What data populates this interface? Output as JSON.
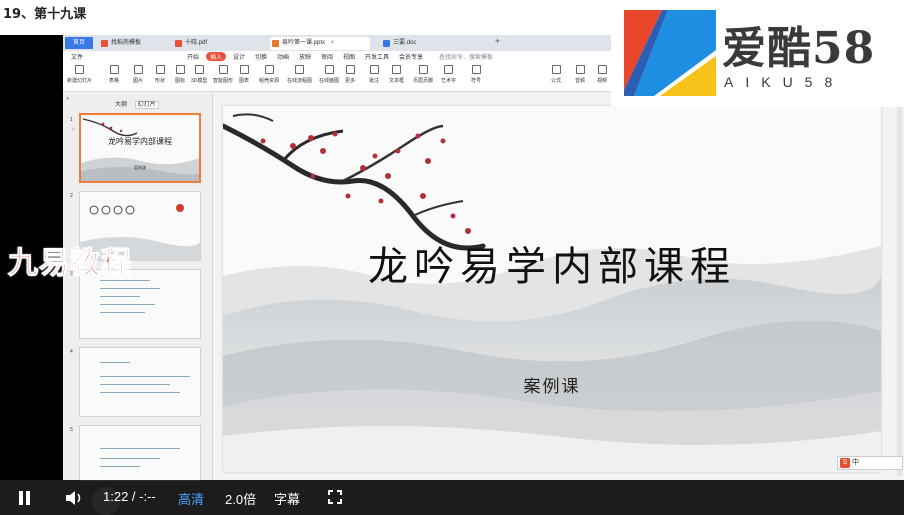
{
  "lesson_title": "19、第十九课",
  "logo": {
    "word": "爱酷58",
    "sub": "AIKU58",
    "colors": [
      "#e8452b",
      "#f6c21a",
      "#1e8ee2",
      "#2c5fb4"
    ]
  },
  "tabs": [
    {
      "label": "首页",
      "type": "home"
    },
    {
      "label": "找稻壳模板",
      "icon_color": "#e94f3c"
    },
    {
      "label": "十晓.pdf",
      "icon_color": "#e94f3c"
    },
    {
      "label": "易吟第一课.pptx",
      "icon_color": "#e87a2a",
      "active": true
    },
    {
      "label": "三要.doc",
      "icon_color": "#3b78e7"
    }
  ],
  "ribbon_menu": [
    "文件",
    "开始",
    "插入",
    "设计",
    "切换",
    "动画",
    "放映",
    "审阅",
    "视图",
    "开发工具",
    "会员专享",
    "查找命令、搜索模板"
  ],
  "ribbon_tools": [
    "新建幻灯片",
    "表格",
    "图片",
    "形状",
    "图标",
    "3D模型",
    "智能图形",
    "图表",
    "稻壳资源",
    "在线流程图",
    "在线脑图",
    "更多",
    "批注",
    "文本框",
    "页眉页脚",
    "艺术字",
    "符号",
    "公式",
    "音频",
    "视频"
  ],
  "panel_tabs": [
    "大纲",
    "幻灯片"
  ],
  "slides": [
    {
      "num": "1",
      "title": "龙吟易学内部课程",
      "sub": "案例课"
    },
    {
      "num": "2"
    },
    {
      "num": "3"
    },
    {
      "num": "4"
    },
    {
      "num": "5"
    }
  ],
  "watermark_text": "九易教程",
  "main_slide": {
    "title": "龙吟易学内部课程",
    "subtitle": "案例课"
  },
  "ime": "中",
  "player": {
    "time": "1:22 / -:--",
    "quality": "高清",
    "speed": "2.0倍",
    "subtitles": "字幕"
  }
}
